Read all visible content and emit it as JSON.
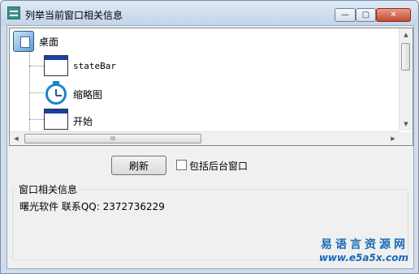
{
  "window": {
    "title": "列举当前窗口相关信息",
    "minimize_glyph": "—",
    "maximize_glyph": "▢",
    "close_glyph": "✕"
  },
  "tree": {
    "root": {
      "label": "桌面",
      "icon": "desktop-icon"
    },
    "children": [
      {
        "label": "stateBar",
        "icon": "window-icon"
      },
      {
        "label": "缩略图",
        "icon": "stopwatch-icon"
      },
      {
        "label": "开始",
        "icon": "window-icon"
      }
    ],
    "scroll_up_glyph": "▲",
    "scroll_down_glyph": "▼",
    "scroll_left_glyph": "◀",
    "scroll_right_glyph": "▶",
    "hthumb_grip": "III"
  },
  "controls": {
    "refresh_label": "刷新",
    "include_background_label": "包括后台窗口",
    "include_background_checked": false
  },
  "info": {
    "group_title": "窗口相关信息",
    "text": "曙光软件 联系QQ: 2372736229"
  },
  "watermark": {
    "line1": "易语言资源网",
    "line2": "www.e5a5x.com"
  }
}
